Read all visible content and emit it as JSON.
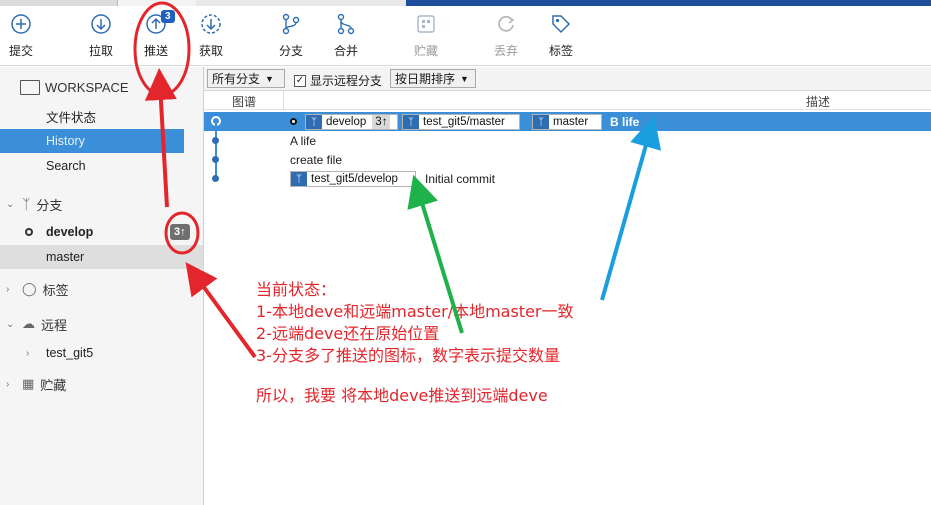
{
  "toolbar": {
    "commit": "提交",
    "pull": "拉取",
    "push": "推送",
    "push_badge": "3",
    "fetch": "获取",
    "branch": "分支",
    "merge": "合并",
    "stash": "贮藏",
    "discard": "丢弃",
    "tag": "标签"
  },
  "sidebar": {
    "workspace": "WORKSPACE",
    "file_status": "文件状态",
    "history": "History",
    "search": "Search",
    "branches": "分支",
    "develop": "develop",
    "develop_count": "3↑",
    "master": "master",
    "tags": "标签",
    "remotes": "远程",
    "remote_name": "test_git5",
    "stashes": "贮藏"
  },
  "filter": {
    "all_branches": "所有分支",
    "show_remote": "显示远程分支",
    "sort": "按日期排序"
  },
  "columns": {
    "graph": "图谱",
    "description": "描述"
  },
  "commits": {
    "row1": {
      "branch_develop": "develop",
      "develop_count": "3↑",
      "remote_master": "test_git5/master",
      "local_master": "master",
      "message": "B life"
    },
    "row2": {
      "message": "A life"
    },
    "row3": {
      "message": "create file"
    },
    "row4": {
      "remote_develop": "test_git5/develop",
      "message": "Initial commit"
    }
  },
  "annotation": {
    "line1": "当前状态：",
    "line2": "1-本地deve和远端master/本地master一致",
    "line3": "2-远端deve还在原始位置",
    "line4": "3-分支多了推送的图标，数字表示提交数量",
    "line5": "所以，我要 将本地deve推送到远端deve"
  },
  "colors": {
    "accent": "#3b8fd8",
    "annotation_red": "#e3262c",
    "arrow_green": "#1fb24a",
    "arrow_blue": "#1a9ee0"
  }
}
